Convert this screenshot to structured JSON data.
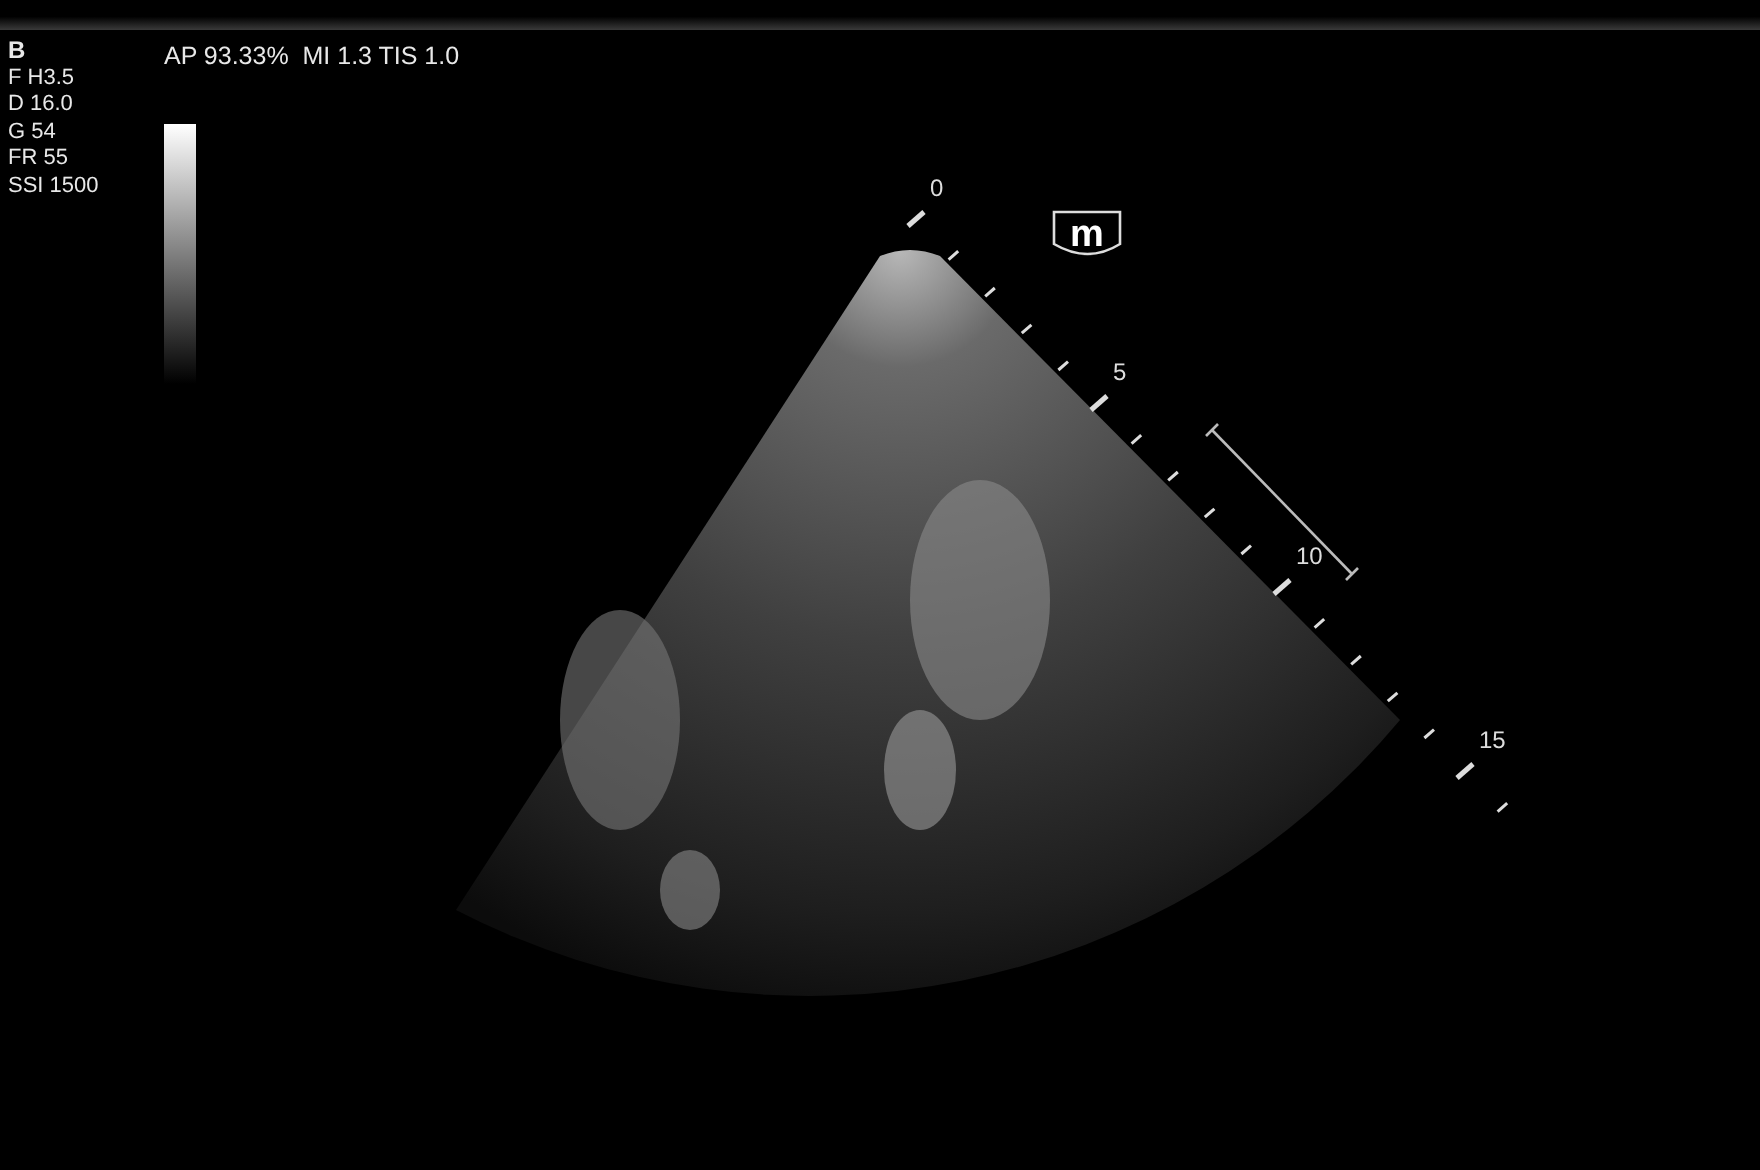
{
  "params": {
    "mode": "B",
    "settings": [
      "F H3.5",
      "D 16.0",
      "G 54",
      "FR 55",
      "SSI 1500"
    ]
  },
  "acoustic_output": "AP 93.33%  MI 1.3 TIS 1.0",
  "orientation_marker": "m",
  "depth_scale": {
    "labels": [
      "0",
      "5",
      "10",
      "15"
    ]
  }
}
